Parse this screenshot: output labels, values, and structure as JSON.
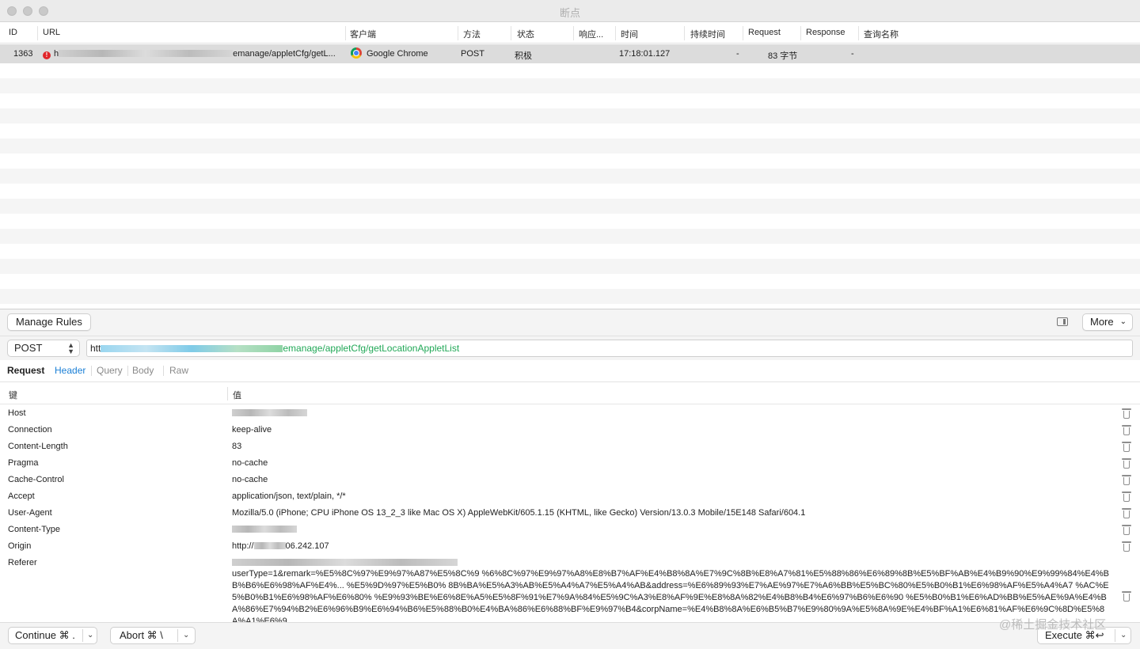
{
  "window": {
    "title": "断点"
  },
  "columns": [
    "ID",
    "URL",
    "客户端",
    "方法",
    "状态",
    "响应...",
    "时间",
    "持续时间",
    "Request",
    "Response",
    "查询名称"
  ],
  "selected_row": {
    "id": "1363",
    "url_prefix": "h",
    "url_suffix": "emanage/appletCfg/getL...",
    "client": "Google Chrome",
    "method": "POST",
    "status": "积极",
    "response": "",
    "time": "17:18:01.127",
    "duration": "-",
    "request": "83 字节",
    "response_size": "-",
    "query_name": ""
  },
  "toolbar": {
    "manage_rules": "Manage Rules",
    "more": "More"
  },
  "request_bar": {
    "method": "POST",
    "url_prefix": "htt",
    "url_suffix": "emanage/appletCfg/getLocationAppletList"
  },
  "tabs": {
    "section": "Request",
    "items": [
      "Header",
      "Query",
      "Body",
      "Raw"
    ],
    "active": "Header"
  },
  "kv_header": {
    "key": "键",
    "value": "值"
  },
  "headers": [
    {
      "key": "Host",
      "value": ""
    },
    {
      "key": "Connection",
      "value": "keep-alive"
    },
    {
      "key": "Content-Length",
      "value": "83"
    },
    {
      "key": "Pragma",
      "value": "no-cache"
    },
    {
      "key": "Cache-Control",
      "value": "no-cache"
    },
    {
      "key": "Accept",
      "value": "application/json, text/plain, */*"
    },
    {
      "key": "User-Agent",
      "value": "Mozilla/5.0 (iPhone; CPU iPhone OS 13_2_3 like Mac OS X) AppleWebKit/605.1.15 (KHTML, like Gecko) Version/13.0.3 Mobile/15E148 Safari/604.1"
    },
    {
      "key": "Content-Type",
      "value": ""
    },
    {
      "key": "Origin",
      "value": "http://"
    },
    {
      "key": "Referer",
      "value": ""
    }
  ],
  "origin_tail": "06.242.107",
  "referer_body": "userType=1&remark=%E5%8C%97%E9%97%A87%E5%8C%9 %6%8C%97%E9%97%A8%E8%B7%AF%E4%B8%8A%E7%9C%8B%E8%A7%81%E5%88%86%E6%89%8B%E5%BF%AB%E4%B9%90%E9%99%84%E4%BB%B6%E6%98%AF%E4%... %E5%9D%97%E5%B0% 8B%BA%E5%A3%AB%E5%A4%A7%E5%A4%AB&address=%E6%89%93%E7%AE%97%E7%A6%BB%E5%BC%80%E5%B0%B1%E6%98%AF%E5%A4%A7 %AC%E5%B0%B1%E6%98%AF%E6%80% %E9%93%BE%E6%8E%A5%E5%8F%91%E7%9A%84%E5%9C%A3%E8%AF%9E%E8%8A%82%E4%B8%B4%E6%97%B6%E6%90 %E5%B0%B1%E6%AD%BB%E5%AE%9A%E4%BA%86%E7%94%B2%E6%96%B9%E6%94%B6%E5%88%B0%E4%BA%86%E6%88%BF%E9%97%B4&corpName=%E4%B8%8A%E6%B5%B7%E9%80%9A%E5%8A%9E%E4%BF%A1%E6%81%AF%E6%9C%8D%E5%8A%A1%E6%9",
  "bottom": {
    "continue": "Continue ⌘ .",
    "abort": "Abort ⌘ \\",
    "execute": "Execute ⌘↩"
  },
  "watermark": "@稀土掘金技术社区"
}
